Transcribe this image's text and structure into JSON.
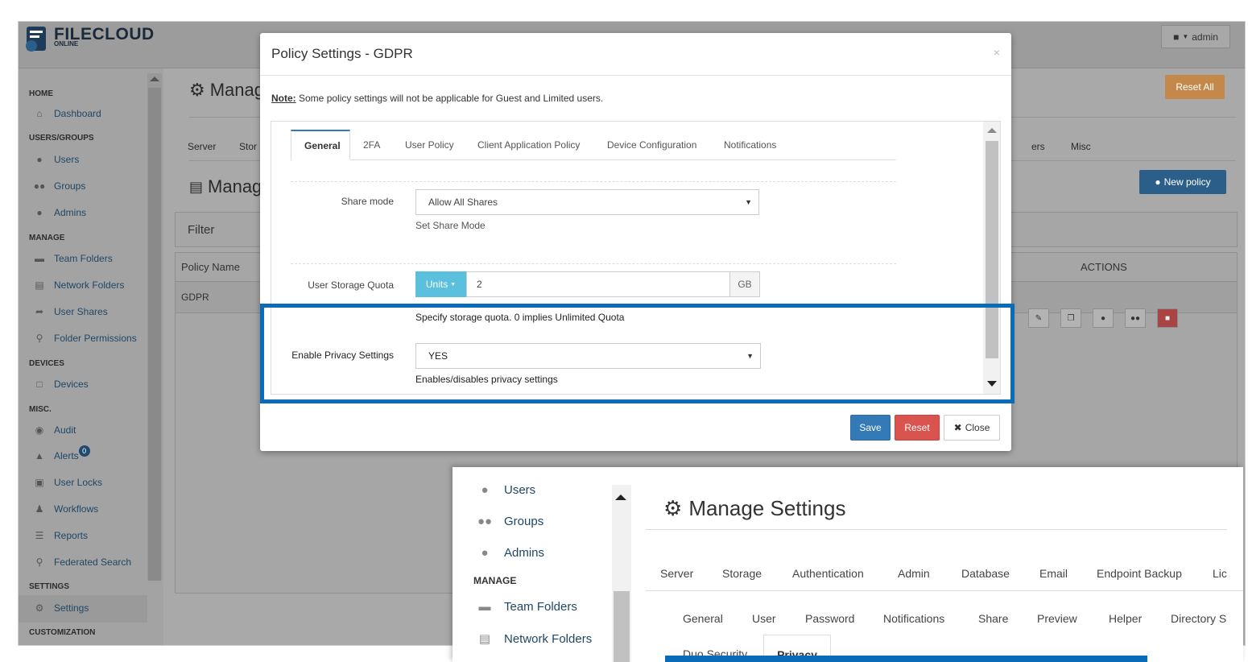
{
  "app": {
    "logo_main": "FILECLOUD",
    "logo_sub": "ONLINE",
    "user_label": "admin"
  },
  "sidebar": {
    "sections": [
      "HOME",
      "USERS/GROUPS",
      "MANAGE",
      "DEVICES",
      "MISC.",
      "SETTINGS",
      "CUSTOMIZATION"
    ],
    "items": [
      {
        "label": "Dashboard",
        "icon": "home-icon"
      },
      {
        "label": "Users",
        "icon": "user-icon"
      },
      {
        "label": "Groups",
        "icon": "users-icon"
      },
      {
        "label": "Admins",
        "icon": "admin-icon"
      },
      {
        "label": "Team Folders",
        "icon": "folder-open-icon"
      },
      {
        "label": "Network Folders",
        "icon": "network-folder-icon"
      },
      {
        "label": "User Shares",
        "icon": "share-icon"
      },
      {
        "label": "Folder Permissions",
        "icon": "key-icon"
      },
      {
        "label": "Devices",
        "icon": "device-icon"
      },
      {
        "label": "Audit",
        "icon": "eye-icon"
      },
      {
        "label": "Alerts",
        "icon": "bell-icon"
      },
      {
        "label": "User Locks",
        "icon": "lock-icon"
      },
      {
        "label": "Workflows",
        "icon": "workflow-icon"
      },
      {
        "label": "Reports",
        "icon": "list-icon"
      },
      {
        "label": "Federated Search",
        "icon": "search-icon"
      },
      {
        "label": "Settings",
        "icon": "gear-icon"
      }
    ],
    "alerts_badge": "0"
  },
  "background": {
    "title_manage": "Manag",
    "title_manage2": "Manag",
    "reset_all": "Reset All",
    "tabs_left": [
      "Server",
      "Stor"
    ],
    "tabs_right": [
      "ers",
      "Misc"
    ],
    "new_policy": "New policy",
    "filter_label": "Filter",
    "col_policy_name": "Policy Name",
    "col_actions": "ACTIONS",
    "row_policy": "GDPR"
  },
  "modal": {
    "title": "Policy Settings - GDPR",
    "close_x": "×",
    "note_bold": "Note:",
    "note_text": " Some policy settings will not be applicable for Guest and Limited users.",
    "tabs": [
      "General",
      "2FA",
      "User Policy",
      "Client Application Policy",
      "Device Configuration",
      "Notifications"
    ],
    "share_mode_label": "Share mode",
    "share_mode_value": "Allow All Shares",
    "share_mode_help": "Set Share Mode",
    "quota_label": "User Storage Quota",
    "units_btn": "Units",
    "quota_value": "2",
    "quota_unit": "GB",
    "quota_help": "Specify storage quota. 0 implies Unlimited Quota",
    "privacy_label": "Enable Privacy Settings",
    "privacy_value": "YES",
    "privacy_help": "Enables/disables privacy settings",
    "save": "Save",
    "reset": "Reset",
    "close": "Close"
  },
  "inset": {
    "items": [
      {
        "label": "Users",
        "icon": "user-icon"
      },
      {
        "label": "Groups",
        "icon": "users-icon"
      },
      {
        "label": "Admins",
        "icon": "admin-icon"
      },
      {
        "label": "Team Folders",
        "icon": "folder-open-icon"
      },
      {
        "label": "Network Folders",
        "icon": "network-folder-icon"
      }
    ],
    "section_manage": "MANAGE",
    "title": "Manage Settings",
    "tabs_top": [
      "Server",
      "Storage",
      "Authentication",
      "Admin",
      "Database",
      "Email",
      "Endpoint Backup",
      "Lic"
    ],
    "tabs_sub": [
      "General",
      "User",
      "Password",
      "Notifications",
      "Share",
      "Preview",
      "Helper",
      "Directory S"
    ],
    "tab_duo": "Duo Security",
    "tab_privacy": "Privacy"
  }
}
